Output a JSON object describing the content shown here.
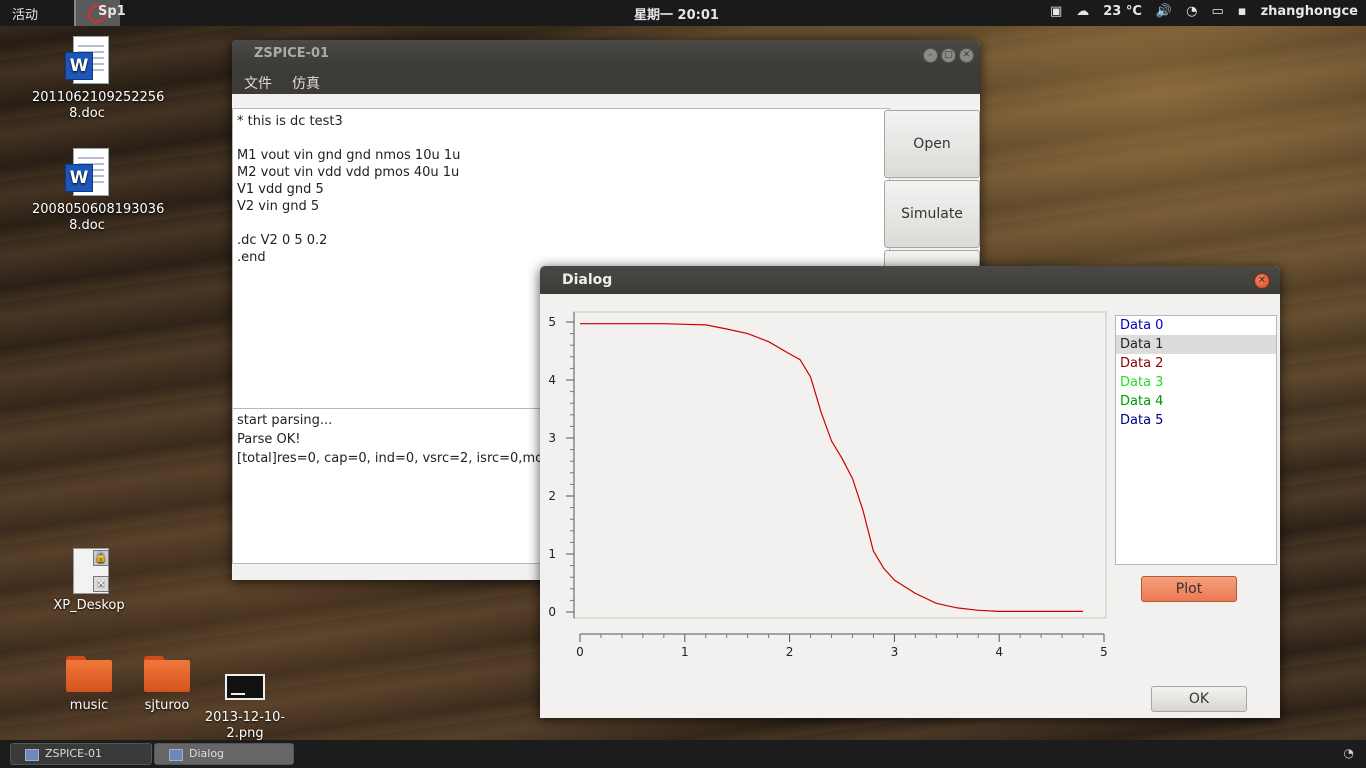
{
  "top_panel": {
    "activities": "活动",
    "focused_app": "Sp1",
    "clock": "星期一 20:01",
    "weather": "23 °C",
    "user": "zhanghongce"
  },
  "desktop": {
    "icons": [
      {
        "label": "2011062109252256\n8.doc"
      },
      {
        "label": "2008050608193036\n8.doc"
      },
      {
        "label": "XP_Deskop"
      },
      {
        "label": "music"
      },
      {
        "label": "sjturoo"
      },
      {
        "label": "2013-12-10-2.png"
      }
    ]
  },
  "main_window": {
    "title": "ZSPICE-01",
    "menu": [
      "文件",
      "仿真"
    ],
    "netlist_lines": [
      "* this is dc test3",
      "",
      "M1 vout vin gnd gnd nmos 10u 1u",
      "M2 vout vin vdd vdd pmos 40u 1u",
      "V1 vdd gnd 5",
      "V2 vin gnd 5",
      "",
      ".dc V2 0 5 0.2",
      ".end"
    ],
    "log_lines": [
      "start parsing...",
      "Parse OK!",
      "[total]res=0, cap=0, ind=0, vsrc=2, isrc=0,mos="
    ],
    "buttons": {
      "open": "Open",
      "simulate": "Simulate"
    }
  },
  "dialog": {
    "title": "Dialog",
    "data_list": [
      {
        "label": "Data 0",
        "color": "#0000c0"
      },
      {
        "label": "Data 1",
        "color": "#222222"
      },
      {
        "label": "Data 2",
        "color": "#8b0000"
      },
      {
        "label": "Data 3",
        "color": "#22dd22"
      },
      {
        "label": "Data 4",
        "color": "#009900"
      },
      {
        "label": "Data 5",
        "color": "#000080"
      }
    ],
    "plot_button": "Plot",
    "ok_button": "OK"
  },
  "chart_data": {
    "type": "line",
    "xlim": [
      0,
      5
    ],
    "ylim": [
      0,
      5
    ],
    "x_ticks": [
      "0",
      "1",
      "2",
      "3",
      "4",
      "5"
    ],
    "y_ticks": [
      "0",
      "1",
      "2",
      "3",
      "4",
      "5"
    ],
    "series": [
      {
        "color": "#cc0000",
        "x": [
          0,
          0.2,
          0.4,
          0.6,
          0.8,
          1.0,
          1.2,
          1.4,
          1.6,
          1.8,
          2.0,
          2.1,
          2.2,
          2.3,
          2.4,
          2.5,
          2.6,
          2.7,
          2.8,
          2.9,
          3.0,
          3.2,
          3.4,
          3.6,
          3.8,
          4.0,
          4.2,
          4.4,
          4.6,
          4.8
        ],
        "y": [
          4.97,
          4.97,
          4.97,
          4.97,
          4.97,
          4.96,
          4.95,
          4.88,
          4.8,
          4.66,
          4.45,
          4.35,
          4.05,
          3.45,
          2.95,
          2.65,
          2.3,
          1.75,
          1.05,
          0.75,
          0.55,
          0.32,
          0.15,
          0.07,
          0.03,
          0.01,
          0.01,
          0.01,
          0.01,
          0.01
        ]
      }
    ]
  },
  "taskbar": {
    "tasks": [
      "ZSPICE-01",
      "Dialog"
    ]
  }
}
